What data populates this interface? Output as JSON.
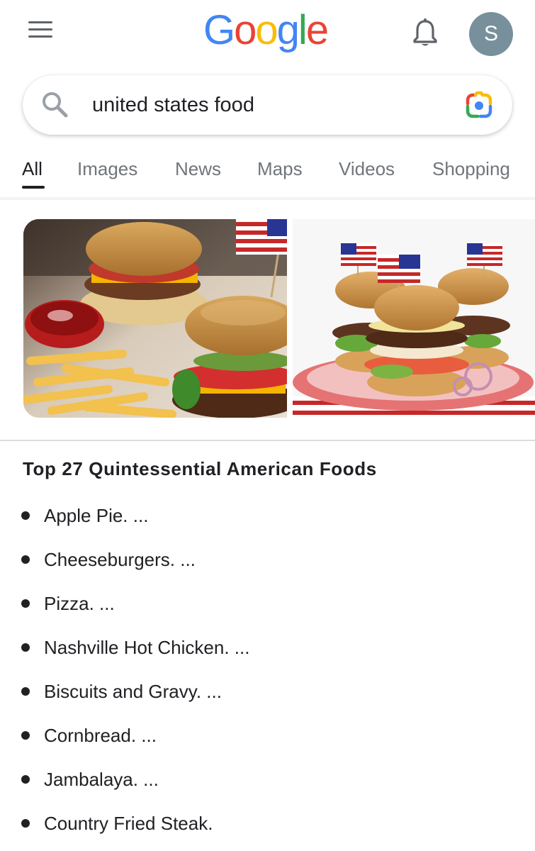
{
  "header": {
    "logo_letters": [
      {
        "char": "G",
        "color": "#4285F4"
      },
      {
        "char": "o",
        "color": "#EA4335"
      },
      {
        "char": "o",
        "color": "#FBBC05"
      },
      {
        "char": "g",
        "color": "#4285F4"
      },
      {
        "char": "l",
        "color": "#34A853"
      },
      {
        "char": "e",
        "color": "#EA4335"
      }
    ],
    "menu_icon": "hamburger-menu-icon",
    "notification_icon": "bell-icon",
    "avatar_initial": "S",
    "avatar_color": "#78909c"
  },
  "search": {
    "query": "united states food",
    "search_icon": "search-icon",
    "lens_icon": "google-lens-camera-icon"
  },
  "tabs": [
    {
      "label": "All",
      "active": true
    },
    {
      "label": "Images",
      "active": false
    },
    {
      "label": "News",
      "active": false
    },
    {
      "label": "Maps",
      "active": false
    },
    {
      "label": "Videos",
      "active": false
    },
    {
      "label": "Shopping",
      "active": false
    }
  ],
  "images": [
    {
      "subject": "cheeseburgers with french fries, ketchup and small american flag"
    },
    {
      "subject": "stack of hamburgers on red plate with american flag toothpicks"
    }
  ],
  "result": {
    "title": "Top 27 Quintessential American Foods",
    "items": [
      "Apple Pie. ...",
      "Cheeseburgers. ...",
      "Pizza. ...",
      "Nashville Hot Chicken. ...",
      "Biscuits and Gravy. ...",
      "Cornbread. ...",
      "Jambalaya. ...",
      "Country Fried Steak."
    ]
  },
  "colors": {
    "tab_active": "#202124",
    "tab_inactive": "#70757a",
    "divider": "#dadce0"
  }
}
